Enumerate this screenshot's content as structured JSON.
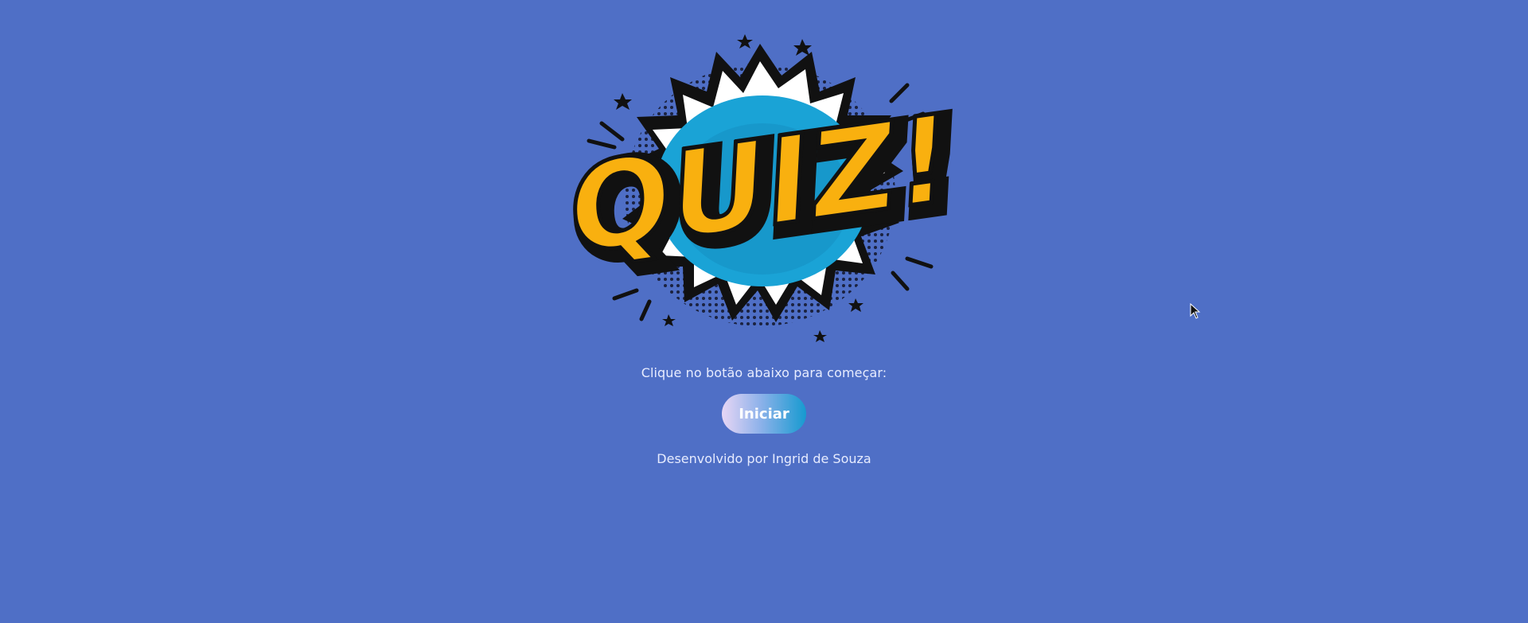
{
  "logo": {
    "text": "QUIZ!",
    "colors": {
      "letters": "#f9b00f",
      "outline": "#111111",
      "burst_inner": "#1aa3d6",
      "burst_ring": "#ffffff",
      "dots": "#1b2240"
    }
  },
  "intro": {
    "instruction": "Clique no botão abaixo para começar:",
    "start_label": "Iniciar",
    "credit": "Desenvolvido por Ingrid de Souza"
  },
  "theme": {
    "background": "#4f6fc6",
    "text": "#e7ecff"
  }
}
